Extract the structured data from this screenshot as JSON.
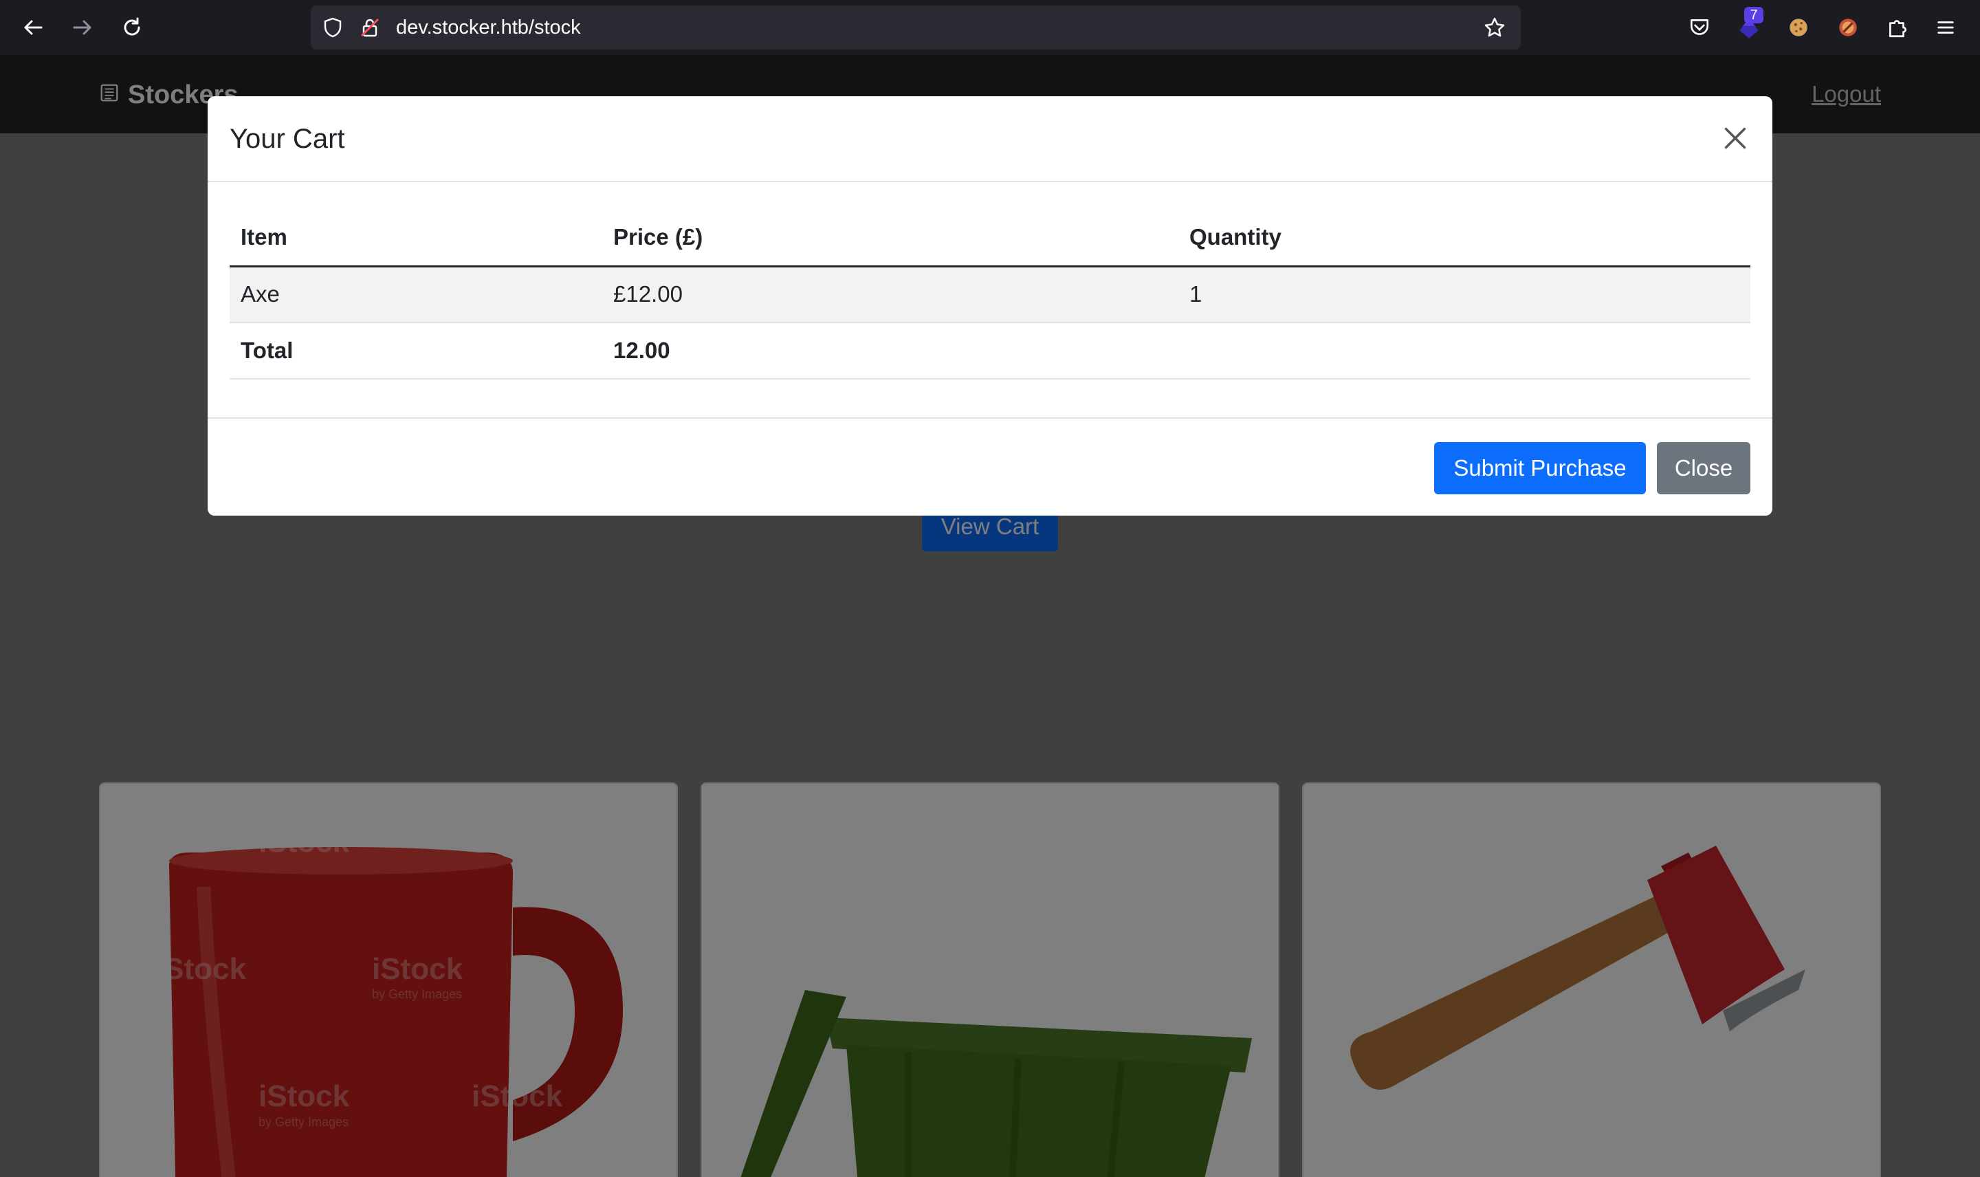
{
  "browser": {
    "url": "dev.stocker.htb/stock",
    "extension_badge": "7"
  },
  "site": {
    "brand": "Stockers",
    "logout": "Logout",
    "view_cart": "View Cart"
  },
  "products": [
    {
      "name": "mug",
      "watermark": "iStock",
      "watermark_sub": "by Getty Images"
    },
    {
      "name": "bin"
    },
    {
      "name": "axe"
    }
  ],
  "modal": {
    "title": "Your Cart",
    "columns": [
      "Item",
      "Price (£)",
      "Quantity"
    ],
    "rows": [
      {
        "item": "Axe",
        "price": "£12.00",
        "quantity": "1"
      }
    ],
    "total": {
      "label": "Total",
      "value": "12.00"
    },
    "submit_label": "Submit Purchase",
    "close_label": "Close"
  },
  "colors": {
    "primary": "#0d6efd",
    "secondary": "#6c757d",
    "navbar": "#212529",
    "browser_chrome": "#1c1b22"
  }
}
